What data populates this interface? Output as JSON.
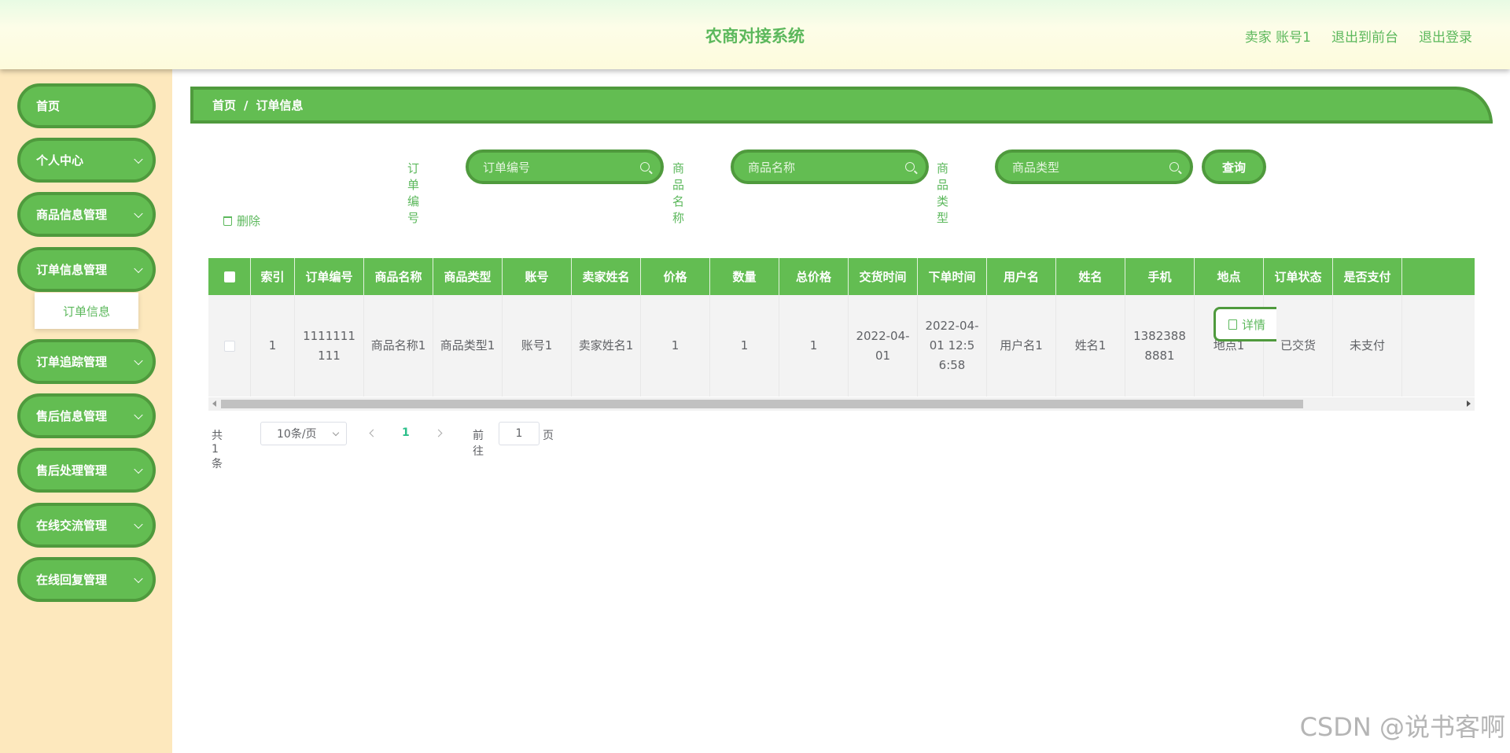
{
  "header": {
    "title": "农商对接系统",
    "user": "卖家 账号1",
    "back_front": "退出到前台",
    "logout": "退出登录"
  },
  "sidebar": {
    "items": [
      {
        "label": "首页"
      },
      {
        "label": "个人中心"
      },
      {
        "label": "商品信息管理"
      },
      {
        "label": "订单信息管理"
      },
      {
        "label": "订单追踪管理"
      },
      {
        "label": "售后信息管理"
      },
      {
        "label": "售后处理管理"
      },
      {
        "label": "在线交流管理"
      },
      {
        "label": "在线回复管理"
      }
    ],
    "submenu": "订单信息"
  },
  "breadcrumb": {
    "home": "首页",
    "sep": "/",
    "current": "订单信息"
  },
  "search": {
    "order_no_label": "订单编号",
    "order_no_placeholder": "订单编号",
    "product_name_label": "商品名称",
    "product_name_placeholder": "商品名称",
    "product_type_label": "商品类型",
    "product_type_placeholder": "商品类型",
    "query_label": "查询"
  },
  "actions": {
    "delete_label": "删除",
    "detail_label": "详情"
  },
  "table": {
    "headers": [
      "索引",
      "订单编号",
      "商品名称",
      "商品类型",
      "账号",
      "卖家姓名",
      "价格",
      "数量",
      "总价格",
      "交货时间",
      "下单时间",
      "用户名",
      "姓名",
      "手机",
      "地点",
      "订单状态",
      "是否支付"
    ],
    "rows": [
      [
        "1",
        "1111111111",
        "商品名称1",
        "商品类型1",
        "账号1",
        "卖家姓名1",
        "1",
        "1",
        "1",
        "2022-04-01",
        "2022-04-01 12:56:58",
        "用户名1",
        "姓名1",
        "13823888881",
        "地点1",
        "已交货",
        "未支付"
      ]
    ]
  },
  "pager": {
    "total": "共 1 条",
    "page_size": "10条/页",
    "current_page": "1",
    "goto_prefix": "前往",
    "goto_value": "1",
    "goto_suffix": "页"
  },
  "watermark": "CSDN @说书客啊",
  "colors": {
    "primary": "#63bd52",
    "primary_border": "#4f9a3d",
    "sidebar_bg": "#fde8bd",
    "text_green": "#5cb85c"
  }
}
